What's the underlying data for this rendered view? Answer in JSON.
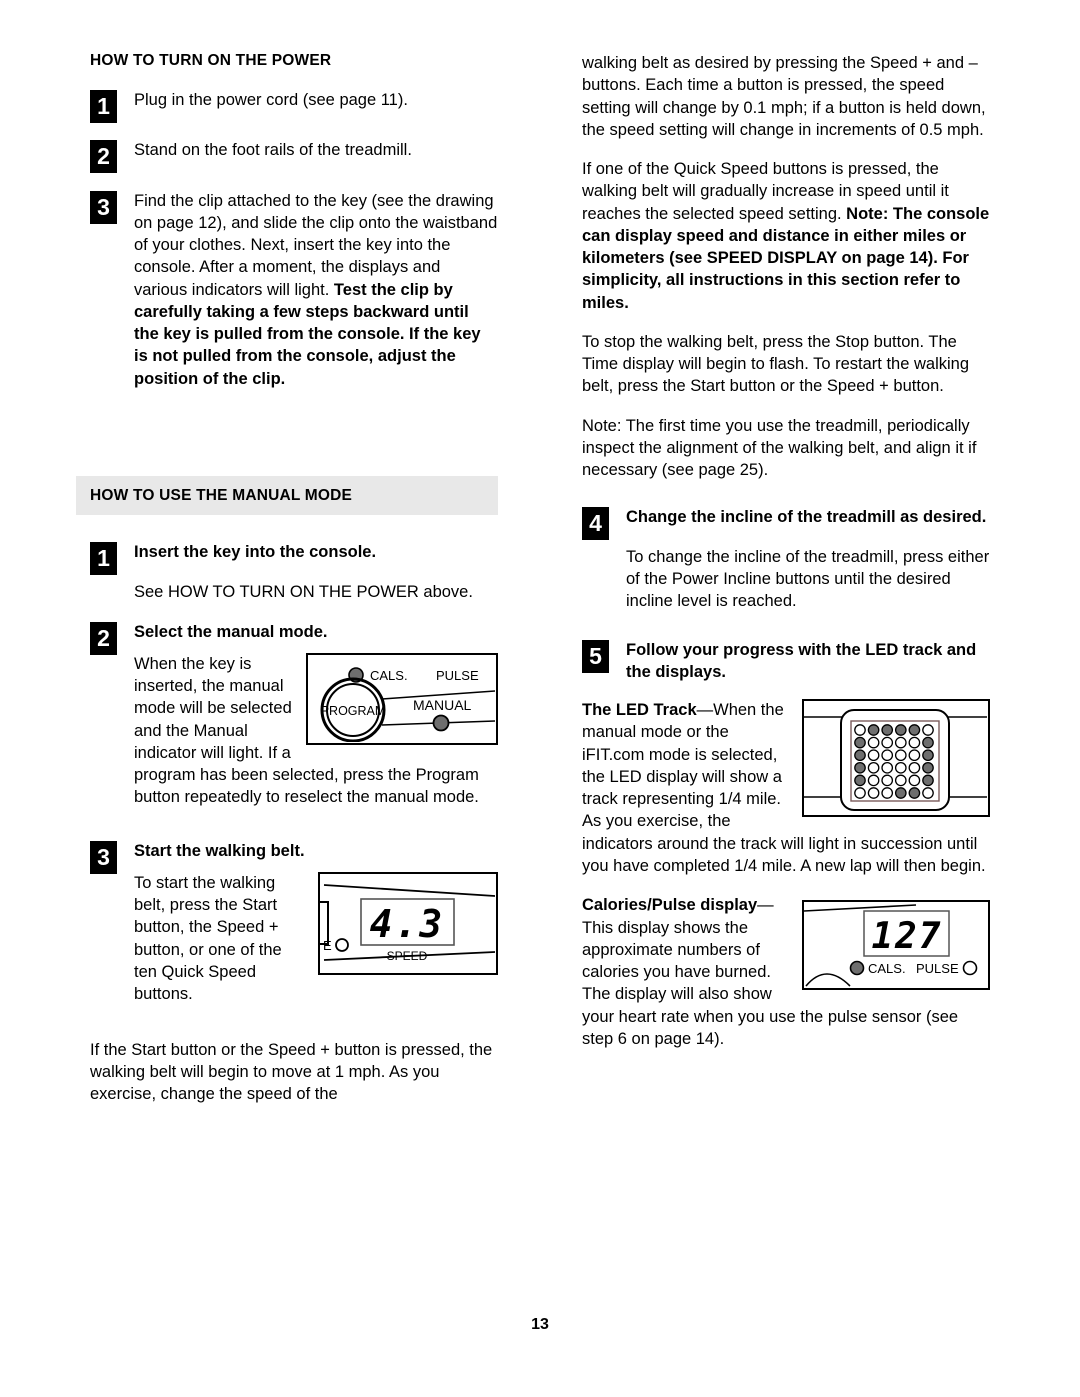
{
  "page": {
    "number": "13"
  },
  "left_column": {
    "section1": {
      "heading": "HOW TO TURN ON THE POWER",
      "steps": [
        {
          "num": "1",
          "text": "Plug in the power cord (see page 11)."
        },
        {
          "num": "2",
          "text": "Stand on the foot rails of the treadmill."
        },
        {
          "num": "3",
          "text_normal": "Find the clip attached to the key (see the drawing on page 12), and slide the clip onto the waistband of your clothes. Next, insert the key into the console. After a moment, the displays and various indicators will light. ",
          "text_bold": "Test the clip by carefully taking a few steps backward until the key is pulled from the console. If the key is not pulled from the console, adjust the position of the clip."
        }
      ]
    },
    "section2": {
      "heading": "HOW TO USE THE MANUAL MODE",
      "step1": {
        "num": "1",
        "title": "Insert the key into the console.",
        "body": "See HOW TO TURN ON THE POWER above."
      },
      "step2": {
        "num": "2",
        "title": "Select the manual mode.",
        "body_wrapped": "When the key is inserted, the manual mode will be selected and the Manual indicator will light. If a program has been selected, press the Program button repeatedly to reselect the manual mode."
      },
      "step3": {
        "num": "3",
        "title": "Start the walking belt.",
        "body_wrapped": "To start the walking belt, press the Start button, the Speed + button, or one of the ten Quick Speed buttons.",
        "body_after": "If the Start button or the Speed + button is pressed, the walking belt will begin to move at 1 mph. As you exercise, change the speed of the"
      }
    },
    "figures": {
      "console": {
        "program_label": "PROGRAM",
        "manual_label": "MANUAL",
        "cals_label": "CALS.",
        "pulse_label": "PULSE"
      },
      "speed": {
        "value": "4.3",
        "label": "SPEED",
        "edge_label": "E"
      }
    }
  },
  "right_column": {
    "para1": "walking belt as desired by pressing the Speed + and – buttons. Each time a button is pressed, the speed setting will change by 0.1 mph; if a button is held down, the speed setting will change in increments of 0.5 mph.",
    "para2_normal": "If one of the Quick Speed buttons is pressed, the walking belt will gradually increase in speed until it reaches the selected speed setting. ",
    "para2_bold": "Note: The console can display speed and distance in either miles or kilometers (see SPEED DISPLAY on page 14). For simplicity, all instructions in this section refer to miles.",
    "para3": "To stop the walking belt, press the Stop button. The Time display will begin to flash. To restart the walking belt, press the Start button or the Speed + button.",
    "para4": "Note: The first time you use the treadmill, periodically inspect the alignment of the walking belt, and align it if necessary (see page 25).",
    "step4": {
      "num": "4",
      "title": "Change the incline of the treadmill as desired.",
      "body": "To change the incline of the treadmill, press either of the Power Incline buttons until the desired incline level is reached."
    },
    "step5": {
      "num": "5",
      "title": "Follow your progress with the LED track and the displays.",
      "led_track_bold": "The LED Track",
      "led_track_text": "—When the manual mode or the iFIT.com mode is selected, the LED display will show a track representing 1/4 mile. As you exercise, the indicators around the track will light in succession until you have completed 1/4 mile. A new lap will then begin.",
      "cals_bold": "Calories/Pulse display",
      "cals_text": "—This display shows the approximate numbers of calories you have burned. The display will also show your heart rate when you use the pulse sensor (see step 6 on page 14)."
    },
    "figures": {
      "led_track": {
        "rows": [
          [
            0,
            1,
            1,
            1,
            1,
            0
          ],
          [
            1,
            0,
            0,
            0,
            0,
            1
          ],
          [
            1,
            0,
            0,
            0,
            0,
            1
          ],
          [
            1,
            0,
            0,
            0,
            0,
            1
          ],
          [
            1,
            0,
            0,
            0,
            0,
            1
          ],
          [
            0,
            0,
            0,
            1,
            1,
            0
          ]
        ]
      },
      "cals_display": {
        "value": "127",
        "cals_label": "CALS.",
        "pulse_label": "PULSE",
        "cals_indicator": "filled",
        "pulse_indicator": "open"
      }
    }
  },
  "colors": {
    "banner_bg": "#e8e8e8",
    "led_on": "#6e6e6e",
    "ink": "#000000"
  }
}
